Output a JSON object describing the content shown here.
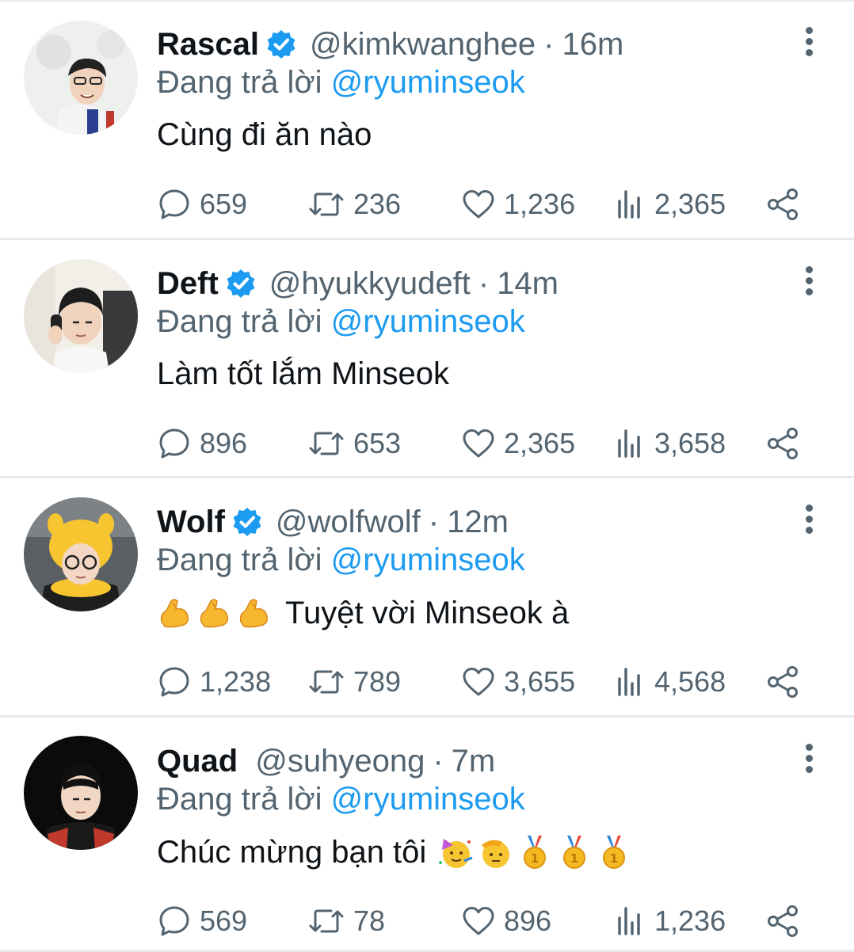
{
  "reply_prefix": "Đang trả lời",
  "colors": {
    "accent": "#1d9bf0",
    "verified": "#1d9bf0",
    "muted_text": "#536471",
    "divider": "#e6e9ec"
  },
  "icons": {
    "reply": "reply-icon",
    "retweet": "retweet-icon",
    "like": "heart-icon",
    "views": "views-icon",
    "share": "share-icon",
    "more": "more-vertical-icon",
    "verified": "verified-badge-icon"
  },
  "tweets": [
    {
      "name": "Rascal",
      "verified": true,
      "handle": "@kimkwanghee",
      "time": "16m",
      "reply_to": "@ryuminseok",
      "text": "Cùng đi ăn nào",
      "emojis": [],
      "replies": "659",
      "retweets": "236",
      "likes": "1,236",
      "views": "2,365"
    },
    {
      "name": "Deft",
      "verified": true,
      "handle": "@hyukkyudeft",
      "time": "14m",
      "reply_to": "@ryuminseok",
      "text": "Làm tốt lắm Minseok",
      "emojis": [],
      "replies": "896",
      "retweets": "653",
      "likes": "2,365",
      "views": "3,658"
    },
    {
      "name": "Wolf",
      "verified": true,
      "handle": "@wolfwolf",
      "time": "12m",
      "reply_to": "@ryuminseok",
      "text": "Tuyệt vời Minseok à",
      "emojis": [
        "flexed-biceps",
        "flexed-biceps",
        "flexed-biceps"
      ],
      "replies": "1,238",
      "retweets": "789",
      "likes": "3,655",
      "views": "4,568"
    },
    {
      "name": "Quad",
      "verified": false,
      "handle": "@suhyeong",
      "time": "7m",
      "reply_to": "@ryuminseok",
      "text": "Chúc mừng bạn tôi",
      "emojis": [
        "partying-face",
        "saluting-face",
        "first-place-medal",
        "first-place-medal",
        "first-place-medal"
      ],
      "replies": "569",
      "retweets": "78",
      "likes": "896",
      "views": "1,236"
    }
  ]
}
